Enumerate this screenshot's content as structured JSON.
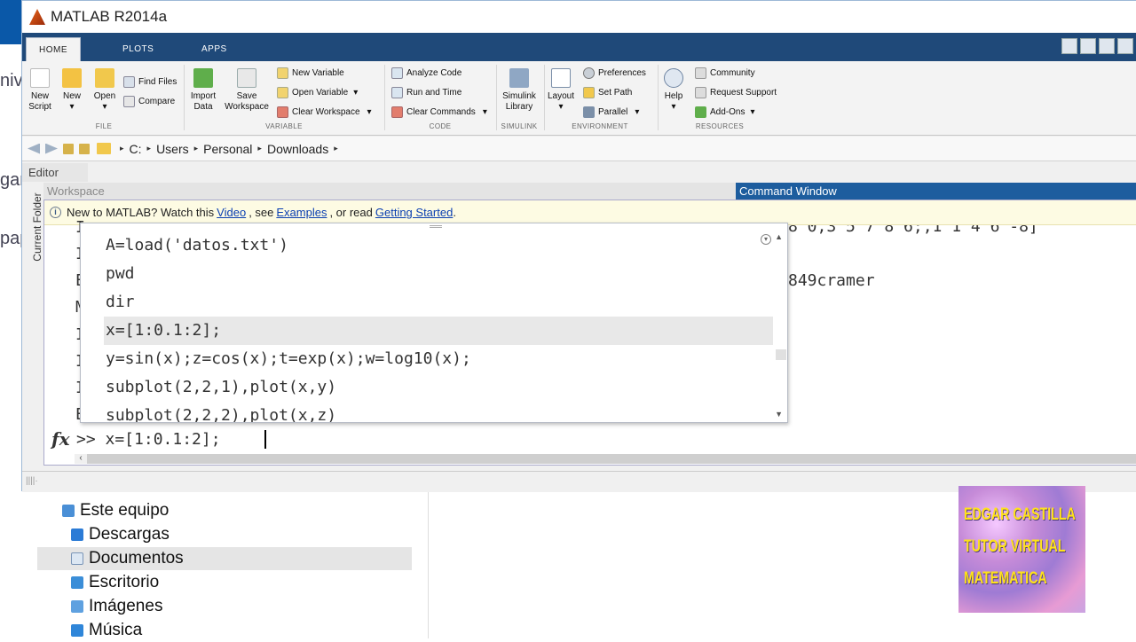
{
  "window": {
    "title": "MATLAB R2014a"
  },
  "tabs": [
    {
      "label": "HOME"
    },
    {
      "label": "PLOTS"
    },
    {
      "label": "APPS"
    }
  ],
  "ribbon": {
    "file": {
      "new_script": [
        "New",
        "Script"
      ],
      "new": [
        "New",
        ""
      ],
      "open": [
        "Open",
        ""
      ],
      "find_files": "Find Files",
      "compare": "Compare",
      "group": "FILE"
    },
    "variable": {
      "import_data": [
        "Import",
        "Data"
      ],
      "save_workspace": [
        "Save",
        "Workspace"
      ],
      "new_variable": "New Variable",
      "open_variable": "Open Variable",
      "clear_workspace": "Clear Workspace",
      "group": "VARIABLE"
    },
    "code": {
      "analyze_code": "Analyze Code",
      "run_and_time": "Run and Time",
      "clear_commands": "Clear Commands",
      "group": "CODE"
    },
    "simulink": {
      "library": [
        "Simulink",
        "Library"
      ],
      "group": "SIMULINK"
    },
    "environment": {
      "layout": "Layout",
      "preferences": "Preferences",
      "set_path": "Set Path",
      "parallel": "Parallel",
      "group": "ENVIRONMENT"
    },
    "resources": {
      "help": "Help",
      "community": "Community",
      "request_support": "Request Support",
      "add_ons": "Add-Ons",
      "group": "RESOURCES"
    }
  },
  "address": {
    "crumbs": [
      "C:",
      "Users",
      "Personal",
      "Downloads"
    ]
  },
  "panels": {
    "editor": "Editor",
    "current_folder": "Current Folder",
    "workspace": "Workspace",
    "command_window": "Command Window"
  },
  "banner": {
    "pre": "New to MATLAB? Watch this",
    "video": "Video",
    "mid": ", see",
    "examples": "Examples",
    "mid2": ", or read",
    "getting_started": "Getting Started",
    "end": "."
  },
  "command_window": {
    "left_glyphs": [
      "I",
      "I",
      "E",
      "M",
      "I",
      "I",
      "I",
      "E"
    ],
    "right_fragments": [
      "8 0,3 5 7 8 6;,1 1 4 6 -8]",
      "849cramer"
    ],
    "prompt": ">> x=[1:0.1:2];"
  },
  "history": {
    "items": [
      "A=load('datos.txt')",
      "pwd",
      "dir",
      "x=[1:0.1:2];",
      "y=sin(x);z=cos(x);t=exp(x);w=log10(x);",
      "subplot(2,2,1),plot(x,y)",
      "subplot(2,2,2),plot(x,z)"
    ],
    "selected_index": 3
  },
  "explorer": {
    "items": [
      "Este equipo",
      "Descargas",
      "Documentos",
      "Escritorio",
      "Imágenes",
      "Música"
    ],
    "selected": "Documentos",
    "left_fragments": [
      "niv",
      "gar",
      "pap"
    ]
  },
  "watermark": {
    "lines": [
      "EDGAR CASTILLA",
      "TUTOR VIRTUAL",
      "MATEMATICA"
    ]
  },
  "colors": {
    "tab_bar": "#1f4979",
    "command_header": "#1d5d9e",
    "banner": "#fdfbe3",
    "link": "#0b3fb1"
  }
}
